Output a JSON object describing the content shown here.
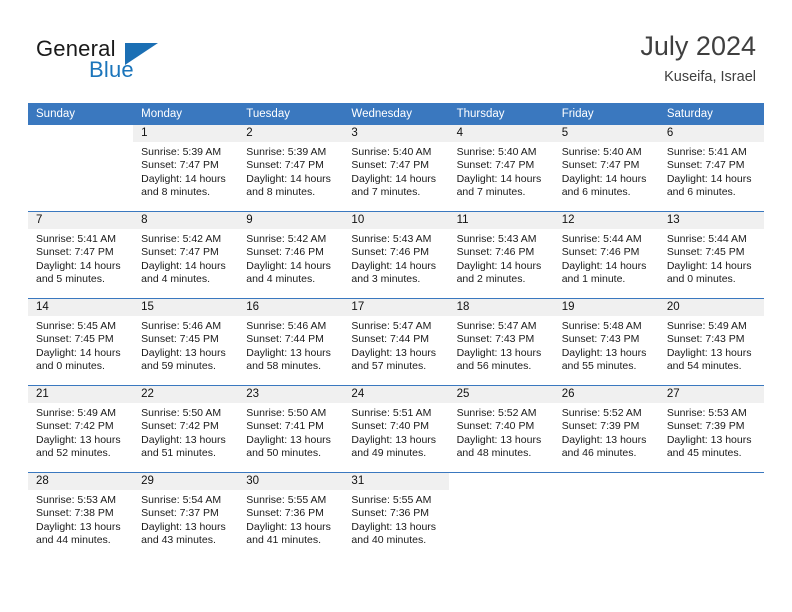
{
  "brand": {
    "name_part1": "General",
    "name_part2": "Blue",
    "flag_icon": "flag-triangle-icon",
    "color_primary": "#1b75bb"
  },
  "header": {
    "month_title": "July 2024",
    "location": "Kuseifa, Israel"
  },
  "colors": {
    "header_row": "#3a78bf",
    "daynum_bar": "#f0f0f0",
    "text": "#1a1a1a",
    "title": "#3f3f3f"
  },
  "calendar": {
    "weekday_headers": [
      "Sunday",
      "Monday",
      "Tuesday",
      "Wednesday",
      "Thursday",
      "Friday",
      "Saturday"
    ],
    "weeks": [
      [
        {
          "day": "",
          "blank": true,
          "sunrise": "",
          "sunset": "",
          "daylight_line1": "",
          "daylight_line2": ""
        },
        {
          "day": "1",
          "sunrise": "Sunrise: 5:39 AM",
          "sunset": "Sunset: 7:47 PM",
          "daylight_line1": "Daylight: 14 hours",
          "daylight_line2": "and 8 minutes."
        },
        {
          "day": "2",
          "sunrise": "Sunrise: 5:39 AM",
          "sunset": "Sunset: 7:47 PM",
          "daylight_line1": "Daylight: 14 hours",
          "daylight_line2": "and 8 minutes."
        },
        {
          "day": "3",
          "sunrise": "Sunrise: 5:40 AM",
          "sunset": "Sunset: 7:47 PM",
          "daylight_line1": "Daylight: 14 hours",
          "daylight_line2": "and 7 minutes."
        },
        {
          "day": "4",
          "sunrise": "Sunrise: 5:40 AM",
          "sunset": "Sunset: 7:47 PM",
          "daylight_line1": "Daylight: 14 hours",
          "daylight_line2": "and 7 minutes."
        },
        {
          "day": "5",
          "sunrise": "Sunrise: 5:40 AM",
          "sunset": "Sunset: 7:47 PM",
          "daylight_line1": "Daylight: 14 hours",
          "daylight_line2": "and 6 minutes."
        },
        {
          "day": "6",
          "sunrise": "Sunrise: 5:41 AM",
          "sunset": "Sunset: 7:47 PM",
          "daylight_line1": "Daylight: 14 hours",
          "daylight_line2": "and 6 minutes."
        }
      ],
      [
        {
          "day": "7",
          "sunrise": "Sunrise: 5:41 AM",
          "sunset": "Sunset: 7:47 PM",
          "daylight_line1": "Daylight: 14 hours",
          "daylight_line2": "and 5 minutes."
        },
        {
          "day": "8",
          "sunrise": "Sunrise: 5:42 AM",
          "sunset": "Sunset: 7:47 PM",
          "daylight_line1": "Daylight: 14 hours",
          "daylight_line2": "and 4 minutes."
        },
        {
          "day": "9",
          "sunrise": "Sunrise: 5:42 AM",
          "sunset": "Sunset: 7:46 PM",
          "daylight_line1": "Daylight: 14 hours",
          "daylight_line2": "and 4 minutes."
        },
        {
          "day": "10",
          "sunrise": "Sunrise: 5:43 AM",
          "sunset": "Sunset: 7:46 PM",
          "daylight_line1": "Daylight: 14 hours",
          "daylight_line2": "and 3 minutes."
        },
        {
          "day": "11",
          "sunrise": "Sunrise: 5:43 AM",
          "sunset": "Sunset: 7:46 PM",
          "daylight_line1": "Daylight: 14 hours",
          "daylight_line2": "and 2 minutes."
        },
        {
          "day": "12",
          "sunrise": "Sunrise: 5:44 AM",
          "sunset": "Sunset: 7:46 PM",
          "daylight_line1": "Daylight: 14 hours",
          "daylight_line2": "and 1 minute."
        },
        {
          "day": "13",
          "sunrise": "Sunrise: 5:44 AM",
          "sunset": "Sunset: 7:45 PM",
          "daylight_line1": "Daylight: 14 hours",
          "daylight_line2": "and 0 minutes."
        }
      ],
      [
        {
          "day": "14",
          "sunrise": "Sunrise: 5:45 AM",
          "sunset": "Sunset: 7:45 PM",
          "daylight_line1": "Daylight: 14 hours",
          "daylight_line2": "and 0 minutes."
        },
        {
          "day": "15",
          "sunrise": "Sunrise: 5:46 AM",
          "sunset": "Sunset: 7:45 PM",
          "daylight_line1": "Daylight: 13 hours",
          "daylight_line2": "and 59 minutes."
        },
        {
          "day": "16",
          "sunrise": "Sunrise: 5:46 AM",
          "sunset": "Sunset: 7:44 PM",
          "daylight_line1": "Daylight: 13 hours",
          "daylight_line2": "and 58 minutes."
        },
        {
          "day": "17",
          "sunrise": "Sunrise: 5:47 AM",
          "sunset": "Sunset: 7:44 PM",
          "daylight_line1": "Daylight: 13 hours",
          "daylight_line2": "and 57 minutes."
        },
        {
          "day": "18",
          "sunrise": "Sunrise: 5:47 AM",
          "sunset": "Sunset: 7:43 PM",
          "daylight_line1": "Daylight: 13 hours",
          "daylight_line2": "and 56 minutes."
        },
        {
          "day": "19",
          "sunrise": "Sunrise: 5:48 AM",
          "sunset": "Sunset: 7:43 PM",
          "daylight_line1": "Daylight: 13 hours",
          "daylight_line2": "and 55 minutes."
        },
        {
          "day": "20",
          "sunrise": "Sunrise: 5:49 AM",
          "sunset": "Sunset: 7:43 PM",
          "daylight_line1": "Daylight: 13 hours",
          "daylight_line2": "and 54 minutes."
        }
      ],
      [
        {
          "day": "21",
          "sunrise": "Sunrise: 5:49 AM",
          "sunset": "Sunset: 7:42 PM",
          "daylight_line1": "Daylight: 13 hours",
          "daylight_line2": "and 52 minutes."
        },
        {
          "day": "22",
          "sunrise": "Sunrise: 5:50 AM",
          "sunset": "Sunset: 7:42 PM",
          "daylight_line1": "Daylight: 13 hours",
          "daylight_line2": "and 51 minutes."
        },
        {
          "day": "23",
          "sunrise": "Sunrise: 5:50 AM",
          "sunset": "Sunset: 7:41 PM",
          "daylight_line1": "Daylight: 13 hours",
          "daylight_line2": "and 50 minutes."
        },
        {
          "day": "24",
          "sunrise": "Sunrise: 5:51 AM",
          "sunset": "Sunset: 7:40 PM",
          "daylight_line1": "Daylight: 13 hours",
          "daylight_line2": "and 49 minutes."
        },
        {
          "day": "25",
          "sunrise": "Sunrise: 5:52 AM",
          "sunset": "Sunset: 7:40 PM",
          "daylight_line1": "Daylight: 13 hours",
          "daylight_line2": "and 48 minutes."
        },
        {
          "day": "26",
          "sunrise": "Sunrise: 5:52 AM",
          "sunset": "Sunset: 7:39 PM",
          "daylight_line1": "Daylight: 13 hours",
          "daylight_line2": "and 46 minutes."
        },
        {
          "day": "27",
          "sunrise": "Sunrise: 5:53 AM",
          "sunset": "Sunset: 7:39 PM",
          "daylight_line1": "Daylight: 13 hours",
          "daylight_line2": "and 45 minutes."
        }
      ],
      [
        {
          "day": "28",
          "sunrise": "Sunrise: 5:53 AM",
          "sunset": "Sunset: 7:38 PM",
          "daylight_line1": "Daylight: 13 hours",
          "daylight_line2": "and 44 minutes."
        },
        {
          "day": "29",
          "sunrise": "Sunrise: 5:54 AM",
          "sunset": "Sunset: 7:37 PM",
          "daylight_line1": "Daylight: 13 hours",
          "daylight_line2": "and 43 minutes."
        },
        {
          "day": "30",
          "sunrise": "Sunrise: 5:55 AM",
          "sunset": "Sunset: 7:36 PM",
          "daylight_line1": "Daylight: 13 hours",
          "daylight_line2": "and 41 minutes."
        },
        {
          "day": "31",
          "sunrise": "Sunrise: 5:55 AM",
          "sunset": "Sunset: 7:36 PM",
          "daylight_line1": "Daylight: 13 hours",
          "daylight_line2": "and 40 minutes."
        },
        {
          "day": "",
          "blank": true,
          "sunrise": "",
          "sunset": "",
          "daylight_line1": "",
          "daylight_line2": ""
        },
        {
          "day": "",
          "blank": true,
          "sunrise": "",
          "sunset": "",
          "daylight_line1": "",
          "daylight_line2": ""
        },
        {
          "day": "",
          "blank": true,
          "sunrise": "",
          "sunset": "",
          "daylight_line1": "",
          "daylight_line2": ""
        }
      ]
    ]
  }
}
